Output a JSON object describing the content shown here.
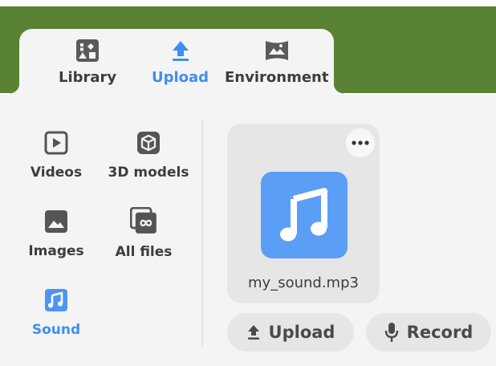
{
  "tabs": [
    {
      "label": "Library",
      "icon": "library-icon",
      "active": false
    },
    {
      "label": "Upload",
      "icon": "upload-icon",
      "active": true
    },
    {
      "label": "Environment",
      "icon": "environment-icon",
      "active": false
    }
  ],
  "categories": [
    {
      "label": "Videos",
      "icon": "video-icon",
      "active": false
    },
    {
      "label": "3D models",
      "icon": "cube-icon",
      "active": false
    },
    {
      "label": "Images",
      "icon": "image-icon",
      "active": false
    },
    {
      "label": "All files",
      "icon": "all-files-icon",
      "active": false
    },
    {
      "label": "Sound",
      "icon": "music-note-icon",
      "active": true
    }
  ],
  "file": {
    "name": "my_sound.mp3",
    "icon": "music-note-icon",
    "menu_icon": "more-icon"
  },
  "actions": {
    "upload_label": "Upload",
    "record_label": "Record"
  },
  "colors": {
    "header": "#5a8234",
    "accent": "#3f8ef0",
    "thumb": "#5a9ef5"
  }
}
